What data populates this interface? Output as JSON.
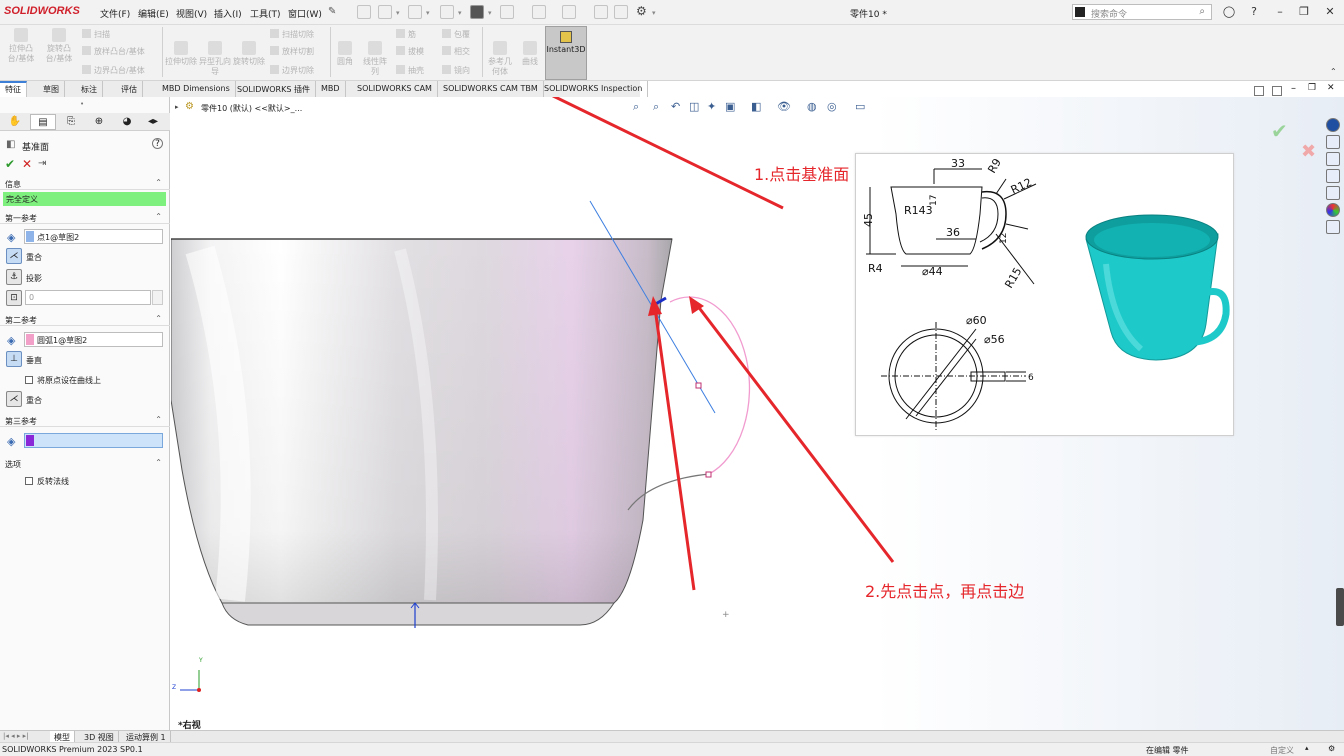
{
  "app": {
    "logo": "SOLIDWORKS",
    "doc_title": "零件10 *"
  },
  "menu": [
    "文件(F)",
    "编辑(E)",
    "视图(V)",
    "插入(I)",
    "工具(T)",
    "窗口(W)"
  ],
  "search": {
    "placeholder": "搜索命令"
  },
  "ribbon": {
    "boss_extrude": "拉伸凸台/基体",
    "boss_revolve": "旋转凸台/基体",
    "sweep": "扫描",
    "loft": "放样凸台/基体",
    "boundary": "边界凸台/基体",
    "cut_extrude": "拉伸切除",
    "hole_wizard": "异型孔向导",
    "cut_revolve": "旋转切除",
    "swept_cut": "扫描切除",
    "lofted_cut": "放样切割",
    "boundary_cut": "边界切除",
    "fillet": "圆角",
    "linear_pattern": "线性阵列",
    "rib": "筋",
    "draft": "拔模",
    "shell": "抽壳",
    "wrap": "包覆",
    "intersect": "相交",
    "mirror": "镜向",
    "ref_geometry": "参考几何体",
    "curves": "曲线",
    "instant3d": "Instant3D"
  },
  "tabs": [
    "特征",
    "草图",
    "标注",
    "评估",
    "MBD Dimensions",
    "SOLIDWORKS 插件",
    "MBD",
    "SOLIDWORKS CAM",
    "SOLIDWORKS CAM TBM",
    "SOLIDWORKS Inspection"
  ],
  "panel": {
    "title": "基准面",
    "info_header": "信息",
    "status": "完全定义",
    "ref1_header": "第一参考",
    "ref1_value": "点1@草图2",
    "ref1_opt1": "重合",
    "ref1_opt2": "投影",
    "ref1_distance": "0",
    "ref2_header": "第二参考",
    "ref2_value": "圆弧1@草图2",
    "ref2_opt1": "垂直",
    "ref2_checkbox": "将原点设在曲线上",
    "ref2_opt2": "重合",
    "ref3_header": "第三参考",
    "options_header": "选项",
    "flip_normal": "反转法线"
  },
  "tree": {
    "node": "零件10 (默认) <<默认>_..."
  },
  "viewport": {
    "annotation1": "1.点击基准面",
    "annotation2": "2.先点击点，再点击边",
    "view_label": "*右视",
    "axis_y": "Y",
    "axis_z": "Z"
  },
  "ref_drawing": {
    "dims": [
      "33",
      "R9",
      "R12",
      "45",
      "R143",
      "17",
      "36",
      "12",
      "R4",
      "⌀44",
      "R15",
      "⌀60",
      "⌀56",
      "6"
    ]
  },
  "bottom_tabs": [
    "模型",
    "3D 视图",
    "运动算例 1"
  ],
  "status": {
    "left": "SOLIDWORKS Premium 2023 SP0.1",
    "mode": "在编辑 零件",
    "custom": "自定义"
  }
}
